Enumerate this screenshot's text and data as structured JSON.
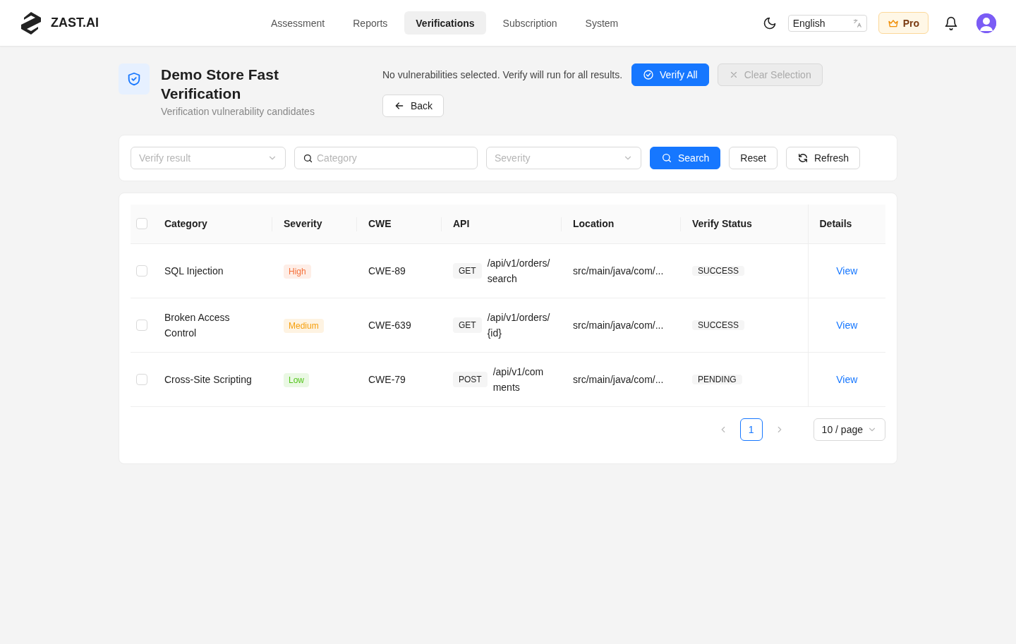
{
  "header": {
    "logo": "ZAST.AI",
    "nav": [
      {
        "label": "Assessment",
        "selected": false
      },
      {
        "label": "Reports",
        "selected": false
      },
      {
        "label": "Verifications",
        "selected": true
      },
      {
        "label": "Subscription",
        "selected": false
      },
      {
        "label": "System",
        "selected": false
      }
    ],
    "language": "English",
    "plan": "Pro"
  },
  "page": {
    "title": "Demo Store Fast Verification",
    "subtitle": "Verification vulnerability candidates",
    "selection_note": "No vulnerabilities selected. Verify will run for all results.",
    "verify_all": "Verify All",
    "clear_selection": {
      "label": "Clear Selection",
      "disabled": true
    },
    "back": "Back"
  },
  "filters": {
    "verify_result": {
      "placeholder": "Verify result"
    },
    "category": {
      "placeholder": "Category"
    },
    "severity": {
      "placeholder": "Severity"
    },
    "search": "Search",
    "reset": "Reset",
    "refresh": "Refresh"
  },
  "table": {
    "select_all": {
      "checked": false
    },
    "columns": [
      "Category",
      "Severity",
      "CWE",
      "API",
      "Location",
      "Verify Status",
      "Details"
    ],
    "rows": [
      {
        "checked": false,
        "category": "SQL Injection",
        "severity": {
          "label": "High",
          "color": "#f5703a"
        },
        "cwe": "CWE-89",
        "method": "GET",
        "api": "/api/v1/orders/search",
        "location": "src/main/java/com/...",
        "status": "SUCCESS",
        "details": "View"
      },
      {
        "checked": false,
        "category": "Broken Access Control",
        "severity": {
          "label": "Medium",
          "color": "#f59e0b"
        },
        "cwe": "CWE-639",
        "method": "GET",
        "api": "/api/v1/orders/{id}",
        "location": "src/main/java/com/...",
        "status": "SUCCESS",
        "details": "View"
      },
      {
        "checked": false,
        "category": "Cross-Site Scripting",
        "severity": {
          "label": "Low",
          "color": "#52c41a"
        },
        "cwe": "CWE-79",
        "method": "POST",
        "api": "/api/v1/comments",
        "location": "src/main/java/com/...",
        "status": "PENDING",
        "details": "View"
      }
    ]
  },
  "pagination": {
    "pages": [
      {
        "label": "1",
        "selected": true
      }
    ],
    "page_size": "10 / page"
  }
}
